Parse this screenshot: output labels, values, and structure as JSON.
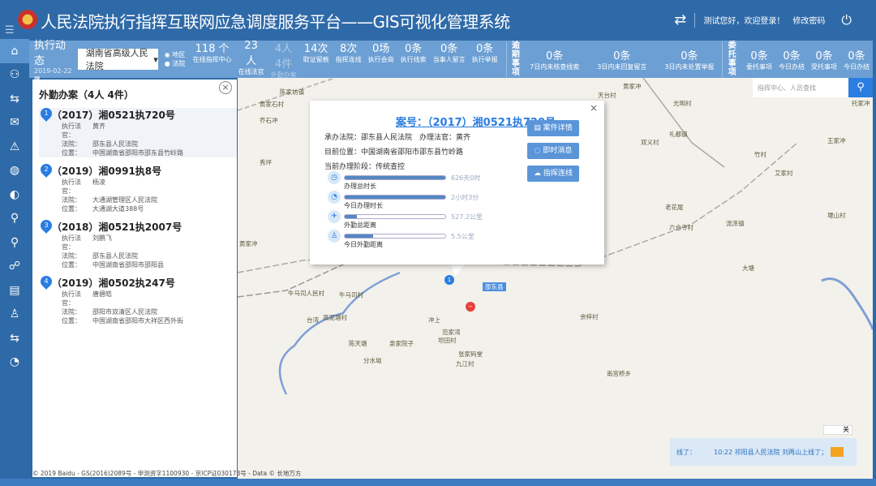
{
  "header": {
    "title": "人民法院执行指挥互联网应急调度服务平台——GIS可视化管理系统",
    "greeting": "测试您好，欢迎登录！",
    "change_password": "修改密码"
  },
  "statbar": {
    "title": "执行动态",
    "date": "2019-02-22",
    "court_select": "湖南省高级人民法院",
    "radio_region": "地区",
    "radio_court": "法院",
    "stats": [
      {
        "v": "118 个",
        "l": "在线指挥中心"
      },
      {
        "v": "23 人",
        "l": "在线法官"
      },
      {
        "v": "4人 4件",
        "l": "外勤办案"
      },
      {
        "v": "14次",
        "l": "取证留痕"
      },
      {
        "v": "8次",
        "l": "指挥连线"
      },
      {
        "v": "0场",
        "l": "执行会商"
      },
      {
        "v": "0条",
        "l": "执行线索"
      },
      {
        "v": "0条",
        "l": "当事人留言"
      },
      {
        "v": "0条",
        "l": "执行举报"
      }
    ],
    "group1": "逾期事项",
    "stats2": [
      {
        "v": "0条",
        "l": "7日内未核查线索"
      },
      {
        "v": "0条",
        "l": "3日内未回复留言"
      },
      {
        "v": "0条",
        "l": "3日内未处置举报"
      }
    ],
    "group2": "委托事项",
    "stats3": [
      {
        "v": "0条",
        "l": "委托事项"
      },
      {
        "v": "0条",
        "l": "今日办结"
      },
      {
        "v": "0条",
        "l": "受托事项"
      },
      {
        "v": "0条",
        "l": "今日办结"
      }
    ]
  },
  "panel": {
    "title": "外勤办案（4人 4件）",
    "labels": {
      "judge": "执行法官：",
      "court": "法院：",
      "loc": "位置："
    },
    "cases": [
      {
        "n": "1",
        "no": "（2017）湘0521执720号",
        "judge": "黄齐",
        "court": "邵东县人民法院",
        "loc": "中国湖南省邵阳市邵东县竹岭路"
      },
      {
        "n": "2",
        "no": "（2019）湘0991执8号",
        "judge": "杨凌",
        "court": "大通湖管理区人民法院",
        "loc": "大通湖大道388号"
      },
      {
        "n": "3",
        "no": "（2018）湘0521执2007号",
        "judge": "刘鹏飞",
        "court": "邵东县人民法院",
        "loc": "中国湖南省邵阳市邵阳县"
      },
      {
        "n": "4",
        "no": "（2019）湘0502执247号",
        "judge": "唐碧皓",
        "court": "邵阳市双清区人民法院",
        "loc": "中国湖南省邵阳市大祥区西外街"
      }
    ]
  },
  "map": {
    "search_placeholder": "指挥中心、人员查找",
    "toggle": "关",
    "labels": [
      "陈家坊镇",
      "黄家石村",
      "乔石冲",
      "秀坪",
      "黄家冲",
      "天台村",
      "光明村",
      "托家冲",
      "双义村",
      "礼都镇",
      "王家冲",
      "竹村",
      "艾家村",
      "老花尾",
      "六合寺村",
      "流泽镇",
      "堰山村",
      "黄家冲",
      "牛马司人民村",
      "牛马司村",
      "台湾",
      "高泥塘村",
      "陈天塘",
      "泉家院子",
      "分水坳",
      "冲上",
      "范家湾",
      "坦田村",
      "张家码堂",
      "九江村",
      "南宫桥乡",
      "大塘",
      "余梓村",
      "邵东县"
    ],
    "popup": {
      "case_no": "案号：（2017）湘0521执720号",
      "court": "承办法院：邵东县人民法院　办理法官：黄齐",
      "location": "目前位置：中国湖南省邵阳市邵东县竹岭路",
      "stage": "当前办理阶段：传统查控",
      "buttons": [
        "案件详情",
        "即时消息",
        "指挥连线"
      ],
      "bars": [
        {
          "label": "办理总时长",
          "value": "626天0时",
          "fill": 1.0
        },
        {
          "label": "今日办理时长",
          "value": "2小时3分",
          "fill": 1.0
        },
        {
          "label": "外勤总距离",
          "value": "527.2公里",
          "fill": 0.12
        },
        {
          "label": "今日外勤距离",
          "value": "5.5公里",
          "fill": 0.28
        }
      ]
    },
    "notice": {
      "prefix": "线了：",
      "message": "10:22 祁阳县人民法院 刘再山上线了；"
    },
    "copyright": "© 2019 Baidu - GS(2016)2089号 - 甲测资字1100930 - 京ICP证030173号 - Data © 长地万方"
  },
  "colors": {
    "header": "#2f6aa8",
    "statbar": "#6c9fd3",
    "accent": "#2a7de1",
    "marker_red": "#e8413c"
  }
}
